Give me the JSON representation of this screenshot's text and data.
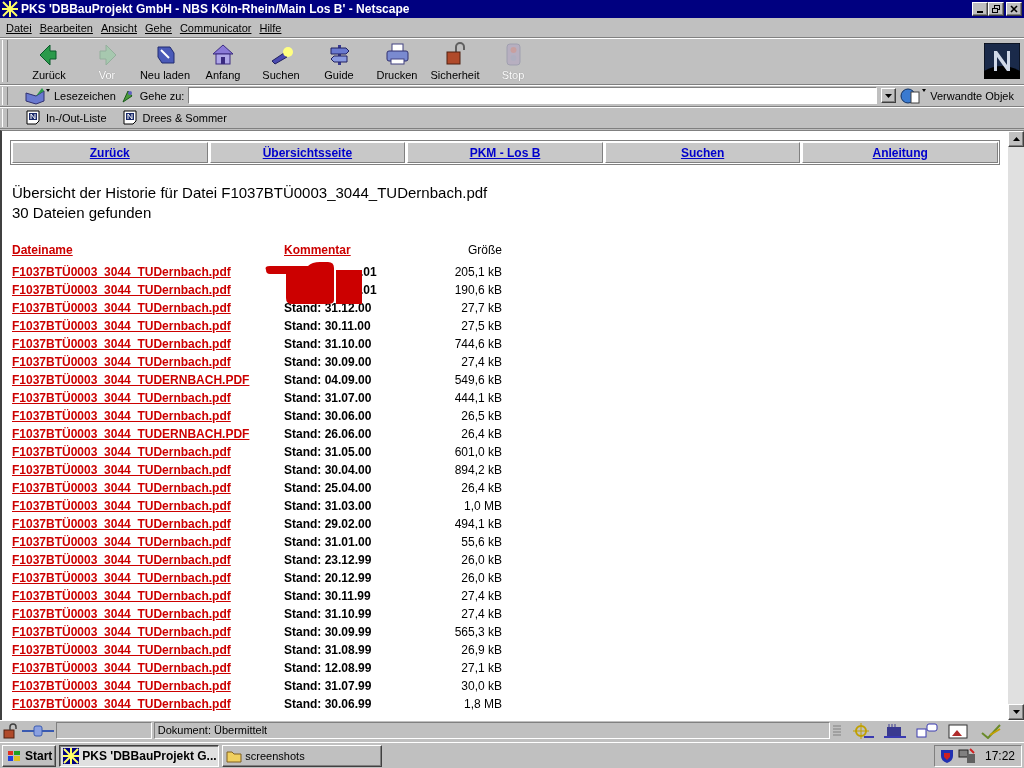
{
  "window": {
    "title": "PKS 'DBBauProjekt GmbH - NBS Köln-Rhein/Main Los B' - Netscape"
  },
  "menu": [
    "Datei",
    "Bearbeiten",
    "Ansicht",
    "Gehe",
    "Communicator",
    "Hilfe"
  ],
  "toolbar": [
    {
      "label": "Zurück",
      "disabled": false
    },
    {
      "label": "Vor",
      "disabled": true
    },
    {
      "label": "Neu laden",
      "disabled": false
    },
    {
      "label": "Anfang",
      "disabled": false
    },
    {
      "label": "Suchen",
      "disabled": false
    },
    {
      "label": "Guide",
      "disabled": false
    },
    {
      "label": "Drucken",
      "disabled": false
    },
    {
      "label": "Sicherheit",
      "disabled": false
    },
    {
      "label": "Stop",
      "disabled": true
    }
  ],
  "location_bar": {
    "bookmarks_label": "Lesezeichen",
    "go_label": "Gehe zu:",
    "related_label": "Verwandte Objek"
  },
  "personal_toolbar": [
    "In-/Out-Liste",
    "Drees & Sommer"
  ],
  "page": {
    "nav_links": [
      "Zurück",
      "Übersichtsseite",
      "PKM - Los B",
      "Suchen",
      "Anleitung"
    ],
    "heading": "Übersicht der Historie für Datei F1037BTÜ0003_3044_TUDernbach.pdf",
    "count": "30 Dateien gefunden",
    "columns": [
      {
        "label": "Dateiname",
        "link": true
      },
      {
        "label": "Kommentar",
        "link": true
      },
      {
        "label": "Größe",
        "link": false
      }
    ],
    "rows": [
      {
        "file": "F1037BTÜ0003_3044_TUDernbach.pdf",
        "comment": ".01",
        "size": "205,1 kB"
      },
      {
        "file": "F1037BTÜ0003_3044_TUDernbach.pdf",
        "comment": ".01",
        "size": "190,6 kB"
      },
      {
        "file": "F1037BTÜ0003_3044_TUDernbach.pdf",
        "comment": "Stand: 31.12.00",
        "size": "27,7 kB"
      },
      {
        "file": "F1037BTÜ0003_3044_TUDernbach.pdf",
        "comment": "Stand: 30.11.00",
        "size": "27,5 kB"
      },
      {
        "file": "F1037BTÜ0003_3044_TUDernbach.pdf",
        "comment": "Stand: 31.10.00",
        "size": "744,6 kB"
      },
      {
        "file": "F1037BTÜ0003_3044_TUDernbach.pdf",
        "comment": "Stand: 30.09.00",
        "size": "27,4 kB"
      },
      {
        "file": "F1037BTÜ0003_3044_TUDERNBACH.PDF",
        "comment": "Stand: 04.09.00",
        "size": "549,6 kB"
      },
      {
        "file": "F1037BTÜ0003_3044_TUDernbach.pdf",
        "comment": "Stand: 31.07.00",
        "size": "444,1 kB"
      },
      {
        "file": "F1037BTÜ0003_3044_TUDernbach.pdf",
        "comment": "Stand: 30.06.00",
        "size": "26,5 kB"
      },
      {
        "file": "F1037BTÜ0003_3044_TUDERNBACH.PDF",
        "comment": "Stand: 26.06.00",
        "size": "26,4 kB"
      },
      {
        "file": "F1037BTÜ0003_3044_TUDernbach.pdf",
        "comment": "Stand: 31.05.00",
        "size": "601,0 kB"
      },
      {
        "file": "F1037BTÜ0003_3044_TUDernbach.pdf",
        "comment": "Stand: 30.04.00",
        "size": "894,2 kB"
      },
      {
        "file": "F1037BTÜ0003_3044_TUDernbach.pdf",
        "comment": "Stand: 25.04.00",
        "size": "26,4 kB"
      },
      {
        "file": "F1037BTÜ0003_3044_TUDernbach.pdf",
        "comment": "Stand: 31.03.00",
        "size": "1,0 MB"
      },
      {
        "file": "F1037BTÜ0003_3044_TUDernbach.pdf",
        "comment": "Stand: 29.02.00",
        "size": "494,1 kB"
      },
      {
        "file": "F1037BTÜ0003_3044_TUDernbach.pdf",
        "comment": "Stand: 31.01.00",
        "size": "55,6 kB"
      },
      {
        "file": "F1037BTÜ0003_3044_TUDernbach.pdf",
        "comment": "Stand: 23.12.99",
        "size": "26,0 kB"
      },
      {
        "file": "F1037BTÜ0003_3044_TUDernbach.pdf",
        "comment": "Stand: 20.12.99",
        "size": "26,0 kB"
      },
      {
        "file": "F1037BTÜ0003_3044_TUDernbach.pdf",
        "comment": "Stand: 30.11.99",
        "size": "27,4 kB"
      },
      {
        "file": "F1037BTÜ0003_3044_TUDernbach.pdf",
        "comment": "Stand: 31.10.99",
        "size": "27,4 kB"
      },
      {
        "file": "F1037BTÜ0003_3044_TUDernbach.pdf",
        "comment": "Stand: 30.09.99",
        "size": "565,3 kB"
      },
      {
        "file": "F1037BTÜ0003_3044_TUDernbach.pdf",
        "comment": "Stand: 31.08.99",
        "size": "26,9 kB"
      },
      {
        "file": "F1037BTÜ0003_3044_TUDernbach.pdf",
        "comment": "Stand: 12.08.99",
        "size": "27,1 kB"
      },
      {
        "file": "F1037BTÜ0003_3044_TUDernbach.pdf",
        "comment": "Stand: 31.07.99",
        "size": "30,0 kB"
      },
      {
        "file": "F1037BTÜ0003_3044_TUDernbach.pdf",
        "comment": "Stand: 30.06.99",
        "size": "1,8 MB"
      }
    ]
  },
  "status_bar": {
    "text": "Dokument: Übermittelt"
  },
  "taskbar": {
    "start": "Start",
    "tasks": [
      {
        "label": "PKS 'DBBauProjekt G...",
        "selected": true
      },
      {
        "label": "screenshots",
        "selected": false
      }
    ],
    "clock": "17:22"
  }
}
